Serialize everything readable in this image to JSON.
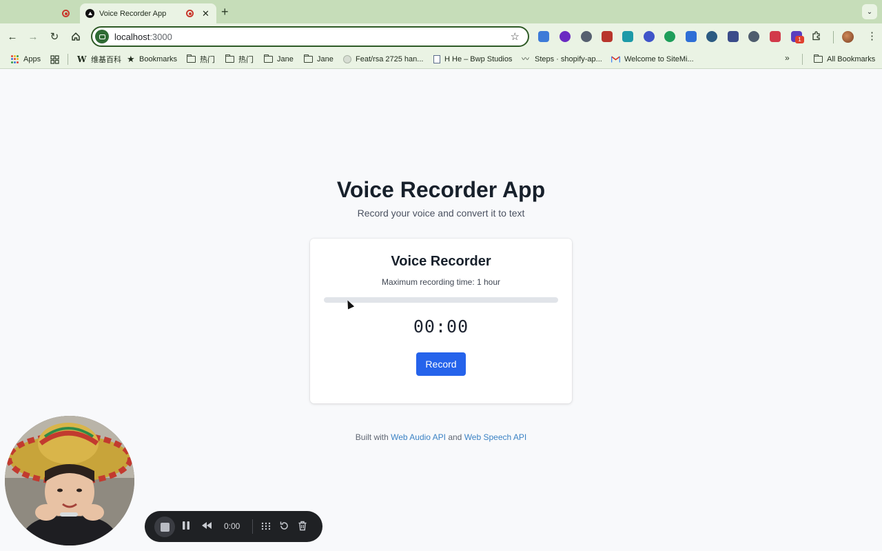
{
  "browser": {
    "inactive_tab": {
      "indicator": "recording-dot"
    },
    "active_tab": {
      "title": "Voice Recorder App",
      "indicator": "recording-dot",
      "close": "✕"
    },
    "new_tab": "+",
    "url_host": "localhost",
    "url_port": ":3000",
    "bookmarks": [
      {
        "label": "Apps",
        "icon": "apps-grid-icon"
      },
      {
        "label": "",
        "icon": "tab-groups-icon"
      },
      {
        "label": "维基百科",
        "icon": "wikipedia-icon"
      },
      {
        "label": "Bookmarks",
        "icon": "star-icon"
      },
      {
        "label": "热门",
        "icon": "folder-icon"
      },
      {
        "label": "热门",
        "icon": "folder-icon"
      },
      {
        "label": "Jane",
        "icon": "folder-icon"
      },
      {
        "label": "Jane",
        "icon": "folder-icon"
      },
      {
        "label": "Feat/rsa 2725 han...",
        "icon": "github-icon"
      },
      {
        "label": "H He – Bwp Studios",
        "icon": "document-icon"
      },
      {
        "label": "Steps · shopify-ap...",
        "icon": "steps-icon"
      },
      {
        "label": "Welcome to SiteMi...",
        "icon": "gmail-icon"
      },
      {
        "label": "All Bookmarks",
        "icon": "folder-icon"
      }
    ],
    "extension_badge": "1",
    "extension_colors": [
      "#3d7bd8",
      "#6a2bc2",
      "#566070",
      "#b8352c",
      "#1d9aa8",
      "#3f55c9",
      "#1e9e5a",
      "#2e6fd6",
      "#2c5b82",
      "#3b4c8a",
      "#4f5d6e",
      "#d23a4a",
      "#5a3fbf"
    ]
  },
  "page": {
    "title": "Voice Recorder App",
    "subtitle": "Record your voice and convert it to text",
    "card": {
      "title": "Voice Recorder",
      "limit": "Maximum recording time: 1 hour",
      "progress_fraction": 0,
      "timer": "00:00",
      "record_label": "Record"
    },
    "footer": {
      "prefix": "Built with ",
      "link1": "Web Audio API",
      "middle": " and ",
      "link2": "Web Speech API"
    },
    "accent_color": "#2563eb"
  },
  "recorder_overlay": {
    "elapsed": "0:00"
  }
}
